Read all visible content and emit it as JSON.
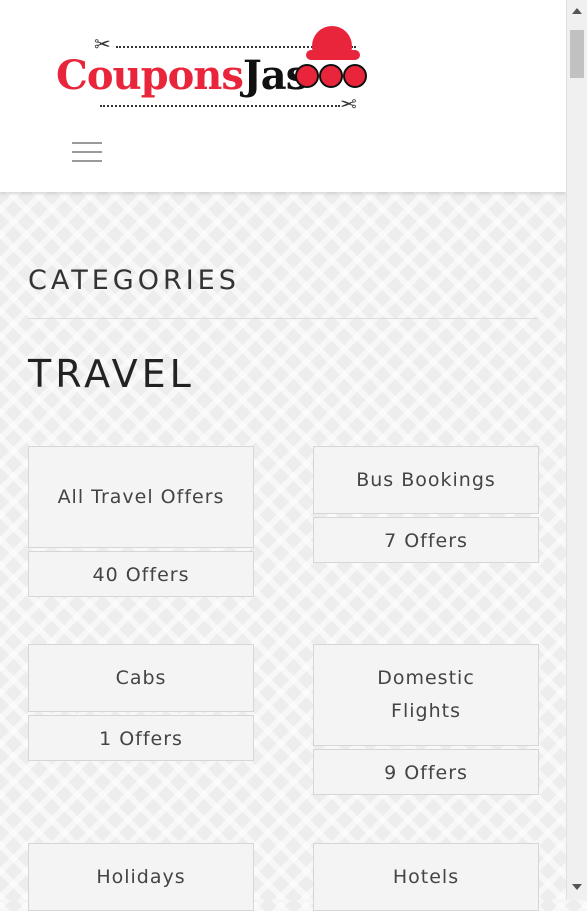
{
  "brand": {
    "name_part1": "Coupons",
    "name_part2": "Jas",
    "accent_color": "#e8253a",
    "dark_color": "#111111"
  },
  "nav": {
    "menu_icon": "hamburger-menu-icon"
  },
  "sidebar": {
    "section_title": "CATEGORIES",
    "category_heading": "TRAVEL",
    "items": [
      {
        "name": "All Travel Offers",
        "offers": "40 Offers"
      },
      {
        "name": "Bus Bookings",
        "offers": "7 Offers"
      },
      {
        "name": "Cabs",
        "offers": "1 Offers"
      },
      {
        "name": "Domestic Flights",
        "offers": "9 Offers"
      },
      {
        "name": "Holidays",
        "offers": ""
      },
      {
        "name": "Hotels",
        "offers": ""
      }
    ]
  }
}
